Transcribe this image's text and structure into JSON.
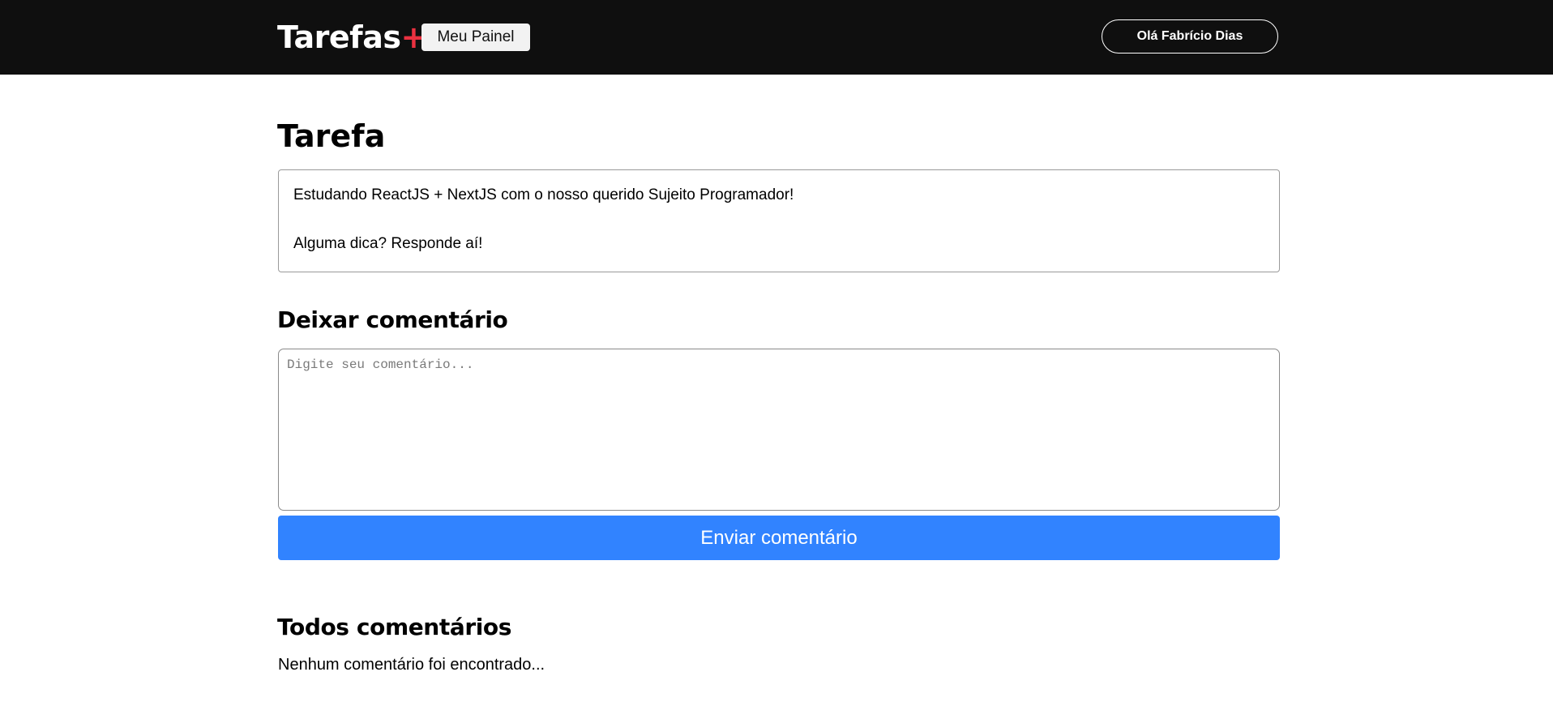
{
  "header": {
    "brand_text": "Tarefas",
    "brand_plus": "+",
    "panel_button_label": "Meu Painel",
    "user_button_label": "Olá Fabrício Dias"
  },
  "task": {
    "title": "Tarefa",
    "lines": [
      "Estudando ReactJS + NextJS com o nosso querido Sujeito Programador!",
      "Alguma dica? Responde aí!"
    ]
  },
  "comment_form": {
    "title": "Deixar comentário",
    "placeholder": "Digite seu comentário...",
    "value": "",
    "submit_label": "Enviar comentário"
  },
  "comments": {
    "title": "Todos comentários",
    "empty_message": "Nenhum comentário foi encontrado..."
  },
  "colors": {
    "header_bg": "#0f0f0f",
    "brand_accent": "#ea3140",
    "submit_bg": "#3183ff"
  }
}
